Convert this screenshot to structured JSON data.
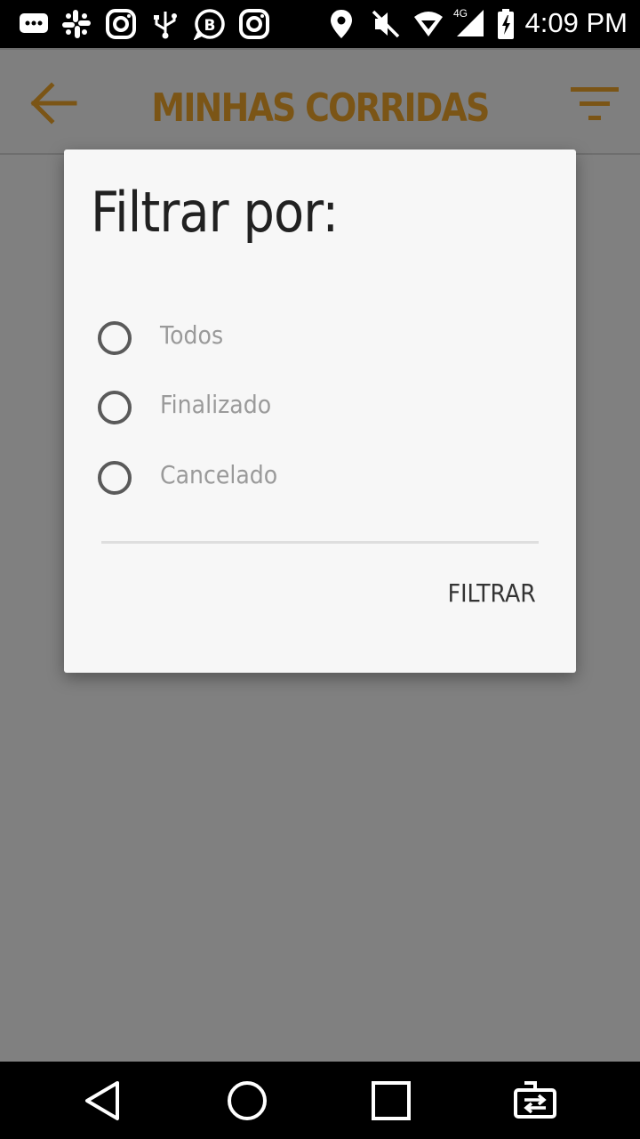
{
  "status_bar": {
    "time": "4:09 PM",
    "network": "4G",
    "icons": [
      "message-icon",
      "slack-icon",
      "instagram-icon",
      "usb-icon",
      "whatsapp-business-icon",
      "instagram-icon",
      "location-icon",
      "mute-icon",
      "wifi-icon",
      "signal-icon",
      "battery-icon"
    ]
  },
  "app_bar": {
    "title": "MINHAS CORRIDAS",
    "title_color": "#7b5516",
    "back_icon": "arrow-left-icon",
    "filter_icon": "filter-icon"
  },
  "dialog": {
    "title": "Filtrar por:",
    "options": [
      {
        "label": "Todos",
        "selected": false
      },
      {
        "label": "Finalizado",
        "selected": false
      },
      {
        "label": "Cancelado",
        "selected": false
      }
    ],
    "action_label": "FILTRAR"
  },
  "nav_bar": {
    "icons": [
      "back-triangle-icon",
      "home-circle-icon",
      "recents-square-icon",
      "switch-app-icon"
    ]
  }
}
